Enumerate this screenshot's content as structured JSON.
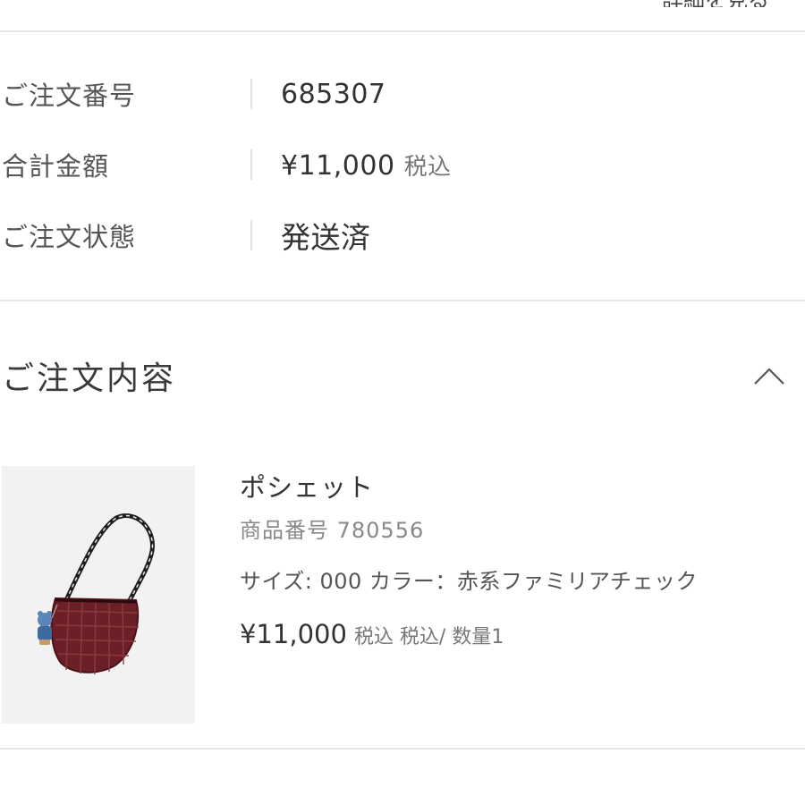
{
  "top_link": {
    "label": "詳細を見る"
  },
  "summary": {
    "rows": [
      {
        "label": "ご注文番号",
        "value": "685307"
      },
      {
        "label": "合計金額",
        "value": "¥11,000",
        "value_suffix": "税込"
      },
      {
        "label": "ご注文状態",
        "value": "発送済"
      }
    ]
  },
  "order_contents": {
    "title": "ご注文内容",
    "toggle_icon": "chevron-up-icon",
    "item": {
      "name": "ポシェット",
      "code": "商品番号 780556",
      "options": "サイズ: 000 カラー：赤系ファミリアチェック",
      "price": "¥11,000",
      "tax_qty": "税込 税込/ 数量1",
      "image": "red-check-pochette-with-bear-charm"
    }
  },
  "colors": {
    "bag": "#6b1f26",
    "divider": "#e6e6e6",
    "text": "#333333"
  }
}
